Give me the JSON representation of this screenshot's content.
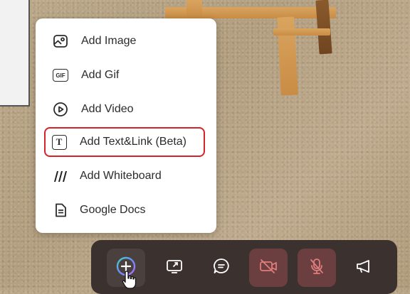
{
  "menu": {
    "items": [
      {
        "label": "Add Image",
        "icon": "image-icon"
      },
      {
        "label": "Add Gif",
        "icon": "gif-icon"
      },
      {
        "label": "Add Video",
        "icon": "video-play-icon"
      },
      {
        "label": "Add Text&Link (Beta)",
        "icon": "text-link-icon"
      },
      {
        "label": "Add Whiteboard",
        "icon": "whiteboard-icon"
      },
      {
        "label": "Google Docs",
        "icon": "document-icon"
      }
    ],
    "highlighted_index": 3,
    "gif_icon_text": "GIF",
    "text_icon_text": "T"
  },
  "toolbar": {
    "buttons": [
      {
        "name": "add-button",
        "icon": "plus-circle-icon"
      },
      {
        "name": "share-screen-button",
        "icon": "screen-share-icon"
      },
      {
        "name": "chat-button",
        "icon": "chat-icon"
      },
      {
        "name": "camera-toggle-button",
        "icon": "camera-off-icon"
      },
      {
        "name": "microphone-toggle-button",
        "icon": "microphone-off-icon"
      },
      {
        "name": "announce-button",
        "icon": "megaphone-icon"
      }
    ]
  },
  "colors": {
    "highlight": "#d5232a",
    "toolbar_bg": "#3b3230",
    "muted_button_bg": "#6b3f3f",
    "muted_icon": "#e07d7d"
  }
}
